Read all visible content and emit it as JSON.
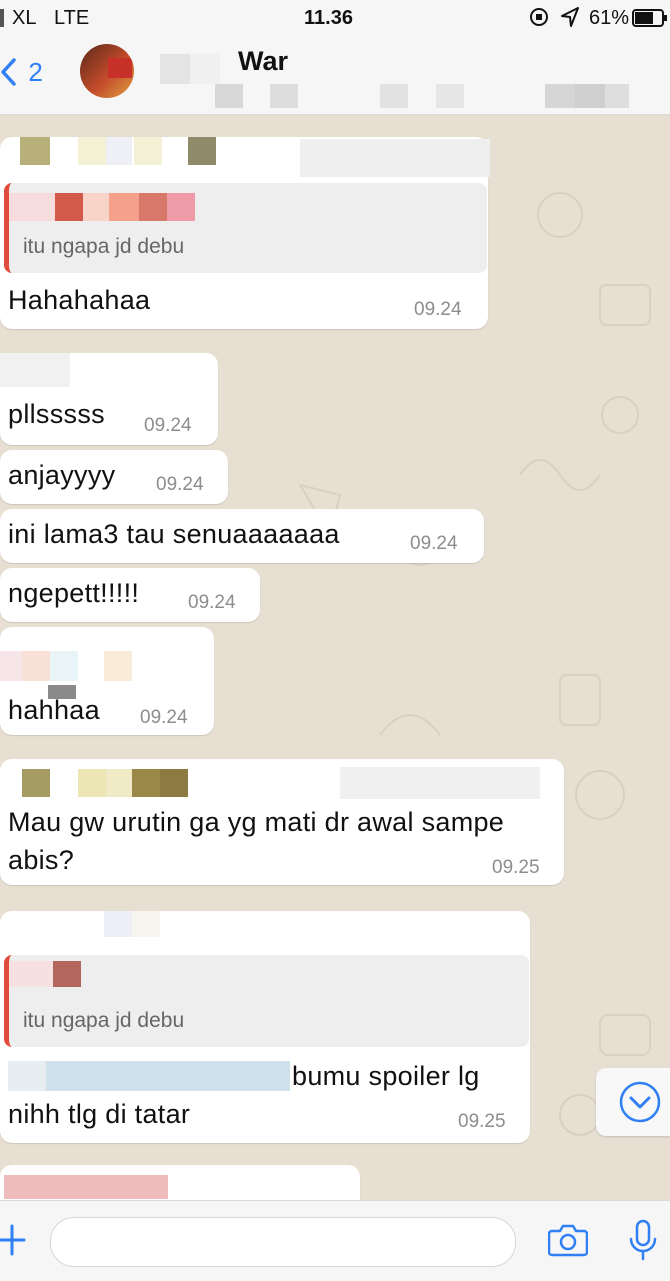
{
  "status_bar": {
    "carrier": "XL",
    "network": "LTE",
    "time": "11.36",
    "battery": "61%"
  },
  "header": {
    "back_count": "2",
    "chat_title": "War"
  },
  "messages": [
    {
      "type": "reply",
      "quote": "itu ngapa jd debu",
      "text": "Hahahahaa",
      "time": "09.24"
    },
    {
      "type": "text",
      "text": "pllsssss",
      "time": "09.24"
    },
    {
      "type": "text",
      "text": "anjayyyy",
      "time": "09.24"
    },
    {
      "type": "text",
      "text": "ini lama3 tau senuaaaaaaa",
      "time": "09.24"
    },
    {
      "type": "text",
      "text": "ngepett!!!!!",
      "time": "09.24"
    },
    {
      "type": "text",
      "text": "hahhaa",
      "time": "09.24"
    },
    {
      "type": "text",
      "text_line1": "Mau gw urutin ga yg mati dr awal sampe",
      "text_line2": "abis?",
      "time": "09.25"
    },
    {
      "type": "reply",
      "quote": "itu ngapa jd debu",
      "text_line1": "bumu spoiler lg",
      "text_line2": "nihh tlg di tatar",
      "time": "09.25"
    }
  ],
  "icons": {
    "back": "chevron-left-icon",
    "scroll_down": "chevron-down-circle-icon",
    "attach": "plus-icon",
    "camera": "camera-icon",
    "mic": "microphone-icon"
  },
  "colors": {
    "accent": "#2f7ff5",
    "bubble": "#ffffff",
    "quote_bar": "#e14b3b",
    "chat_bg": "#e8dfd3"
  }
}
